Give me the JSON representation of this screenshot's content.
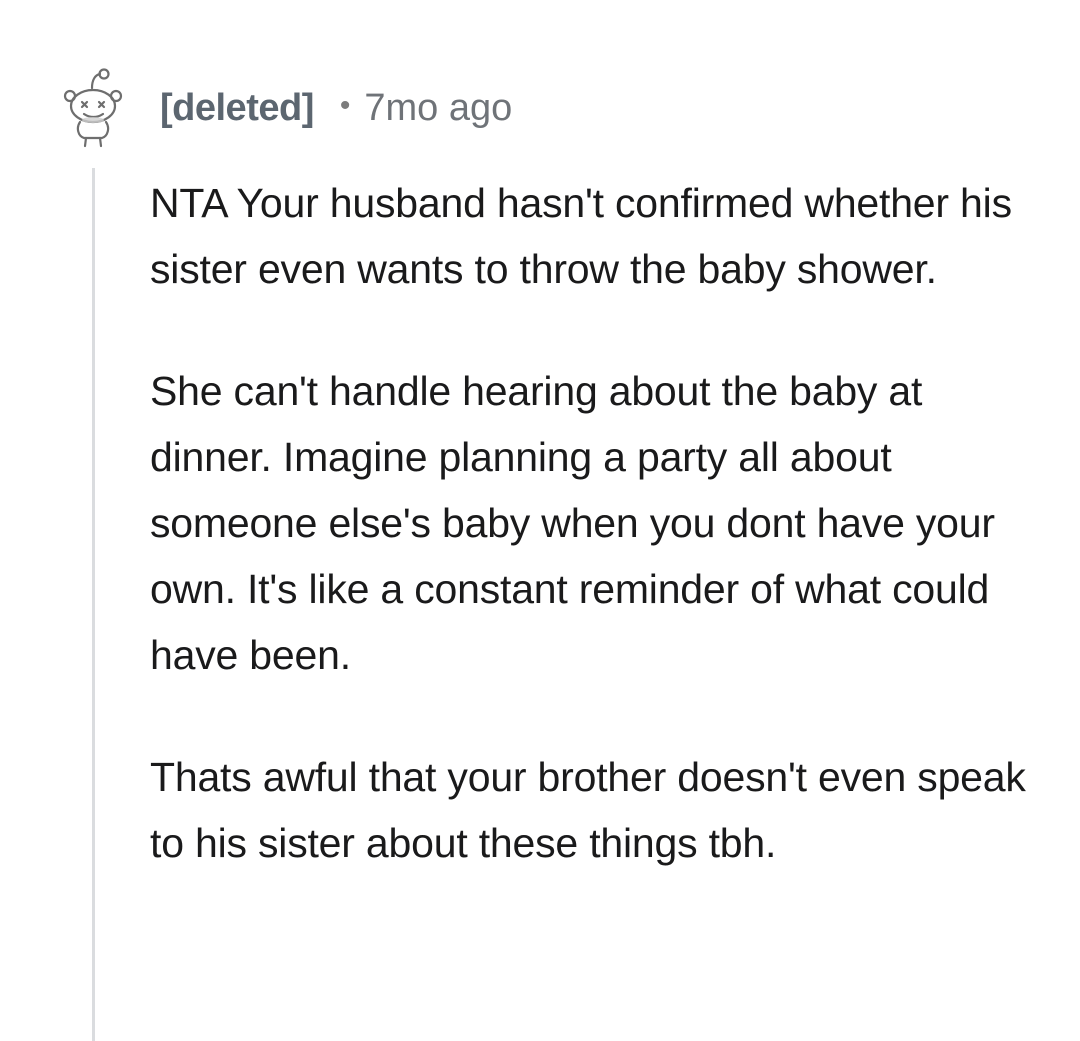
{
  "comment": {
    "author": "[deleted]",
    "separator": "•",
    "timestamp": "7mo ago",
    "avatar_icon": "reddit-snoo-icon",
    "paragraphs": [
      "NTA Your husband hasn't confirmed whether his sister even wants to throw the baby shower.",
      "She can't handle hearing about the baby at dinner. Imagine planning a party all about someone else's baby when you dont have your own. It's like a constant reminder of what could have been.",
      "Thats awful that your brother doesn't even speak to his sister about these things tbh."
    ]
  },
  "colors": {
    "author": "#5c6670",
    "timestamp": "#6f7378",
    "body_text": "#1a1a1b",
    "thread_line": "#dadcdf",
    "background": "#ffffff"
  }
}
